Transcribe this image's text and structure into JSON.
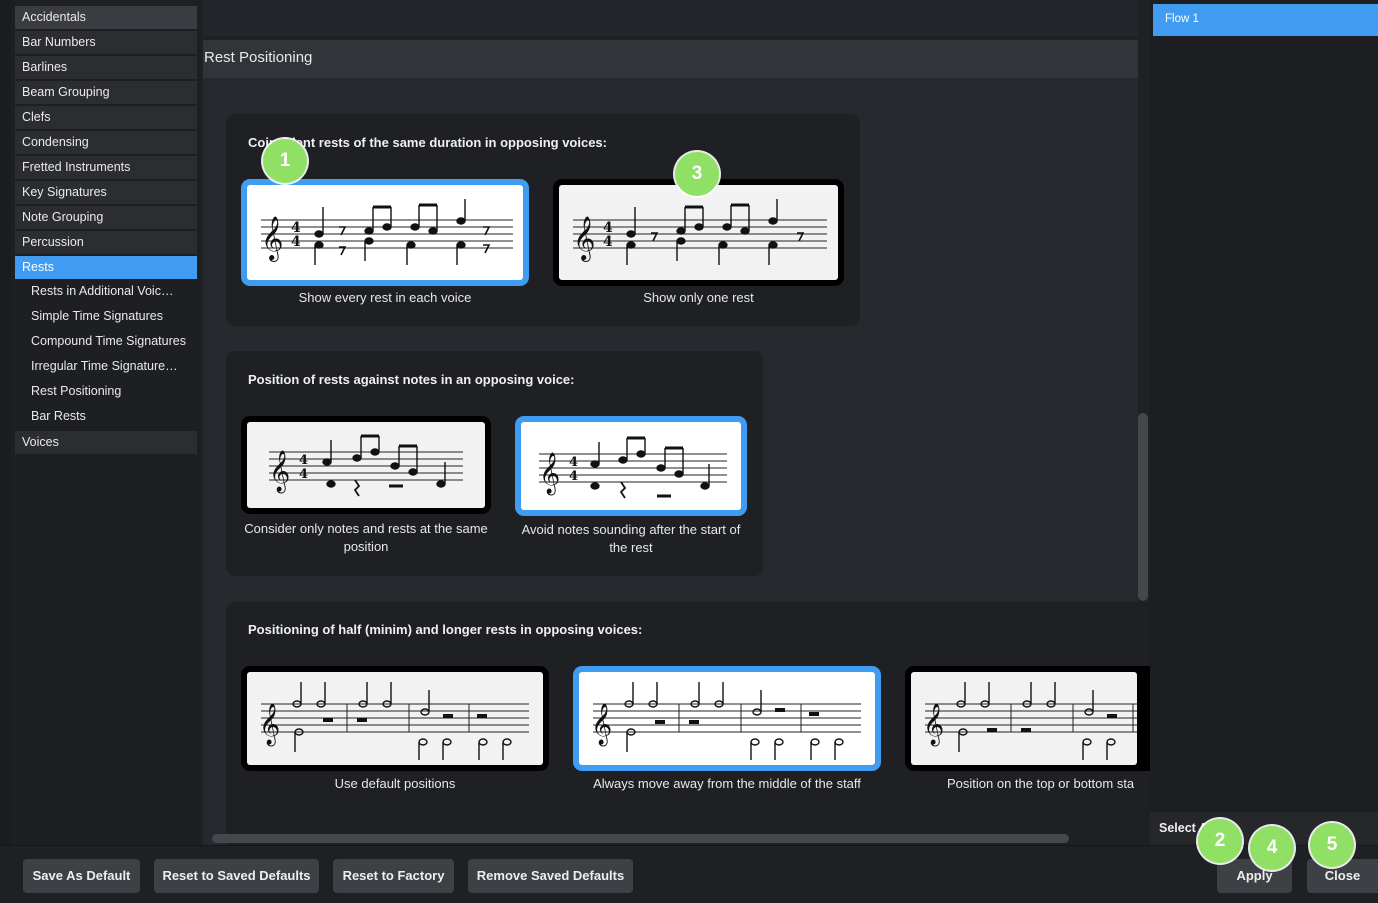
{
  "sidebar": {
    "items": [
      {
        "label": "Accidentals"
      },
      {
        "label": "Bar Numbers"
      },
      {
        "label": "Barlines"
      },
      {
        "label": "Beam Grouping"
      },
      {
        "label": "Clefs"
      },
      {
        "label": "Condensing"
      },
      {
        "label": "Fretted Instruments"
      },
      {
        "label": "Key Signatures"
      },
      {
        "label": "Note Grouping"
      },
      {
        "label": "Percussion"
      },
      {
        "label": "Rests"
      }
    ],
    "subitems": [
      {
        "label": "Rests in Additional Voic…"
      },
      {
        "label": "Simple Time Signatures"
      },
      {
        "label": "Compound Time Signatures"
      },
      {
        "label": "Irregular Time Signature…"
      },
      {
        "label": "Rest Positioning"
      },
      {
        "label": "Bar Rests"
      }
    ],
    "after": {
      "label": "Voices"
    }
  },
  "section": {
    "title": "Rest Positioning"
  },
  "groups": [
    {
      "title": "Coincident rests of the same duration in opposing voices:",
      "options": [
        {
          "caption": "Show every rest in each voice"
        },
        {
          "caption": "Show only one rest"
        }
      ]
    },
    {
      "title": "Position of rests against notes in an opposing voice:",
      "options": [
        {
          "caption": "Consider only notes and rests at the same position"
        },
        {
          "caption": "Avoid notes sounding after the start of the rest"
        }
      ]
    },
    {
      "title": "Positioning of half (minim) and longer rests in opposing voices:",
      "options": [
        {
          "caption": "Use default positions"
        },
        {
          "caption": "Always move away from the middle of the staff"
        },
        {
          "caption": "Position on the top or bottom sta"
        }
      ]
    }
  ],
  "right_panel": {
    "flow": "Flow 1",
    "select_all": "Select All"
  },
  "buttons": {
    "save_default": "Save As Default",
    "reset_saved": "Reset to Saved Defaults",
    "reset_factory": "Reset to Factory",
    "remove_saved": "Remove Saved Defaults",
    "apply": "Apply",
    "close": "Close"
  },
  "badges": [
    "1",
    "2",
    "3",
    "4",
    "5"
  ],
  "colors": {
    "accent": "#3f9cf0",
    "badge": "#8fe065"
  }
}
